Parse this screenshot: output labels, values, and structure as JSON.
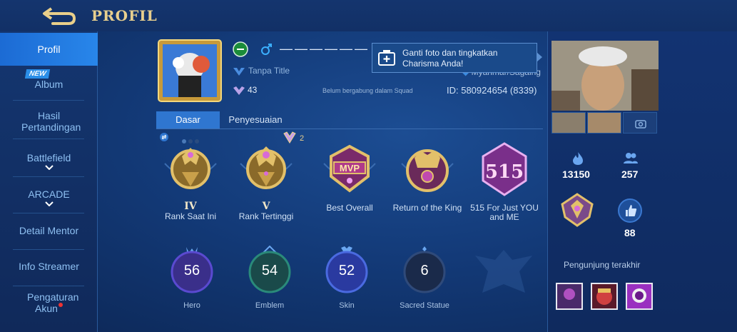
{
  "header": {
    "title": "PROFIL",
    "back_icon": "back-arrow-icon"
  },
  "sidebar": {
    "items": [
      {
        "label": "Profil",
        "active": true
      },
      {
        "label": "Album",
        "badge": "NEW"
      },
      {
        "label": "Hasil Pertandingan"
      },
      {
        "label": "Battlefield",
        "expandable": true
      },
      {
        "label": "ARCADE",
        "expandable": true
      },
      {
        "label": "Detail Mentor"
      },
      {
        "label": "Info Streamer"
      },
      {
        "label": "Pengaturan Akun",
        "notification_dot": true
      }
    ]
  },
  "profile": {
    "name": "——————",
    "title": "Tanpa Title",
    "level": "43",
    "squad_status": "Belum bergabung dalam Squad",
    "location": "Myanmar/Sagaing",
    "id_text": "ID: 580924654 (8339)",
    "tooltip": "Ganti foto dan tingkatkan Charisma Anda!"
  },
  "tabs": [
    {
      "label": "Dasar",
      "active": true
    },
    {
      "label": "Penyesuaian",
      "active": false
    }
  ],
  "medal_badge_count": "2",
  "medals": [
    {
      "tier": "IV",
      "label": "Rank Saat Ini",
      "icon": "rank-medal-icon"
    },
    {
      "tier": "V",
      "label": "Rank Tertinggi",
      "icon": "rank-medal-icon"
    },
    {
      "tier": "",
      "label": "Best Overall",
      "icon": "best-overall-badge-icon",
      "emblem_text": "MVP"
    },
    {
      "tier": "",
      "label": "Return of the King",
      "icon": "king-medal-icon"
    },
    {
      "tier": "",
      "label": "515 For Just YOU and ME",
      "icon": "515-event-badge-icon",
      "emblem_text": "515"
    }
  ],
  "stats": [
    {
      "value": "56",
      "label": "Hero",
      "icon": "hero-icon"
    },
    {
      "value": "54",
      "label": "Emblem",
      "icon": "emblem-icon"
    },
    {
      "value": "52",
      "label": "Skin",
      "icon": "skin-icon"
    },
    {
      "value": "6",
      "label": "Sacred Statue",
      "icon": "statue-icon"
    }
  ],
  "right_panel": {
    "popularity": "13150",
    "followers": "257",
    "likes": "88",
    "visitors_title": "Pengunjung terakhir"
  },
  "colors": {
    "accent": "#2f76d0",
    "gold": "#e8cf8e",
    "background": "#133a78"
  }
}
